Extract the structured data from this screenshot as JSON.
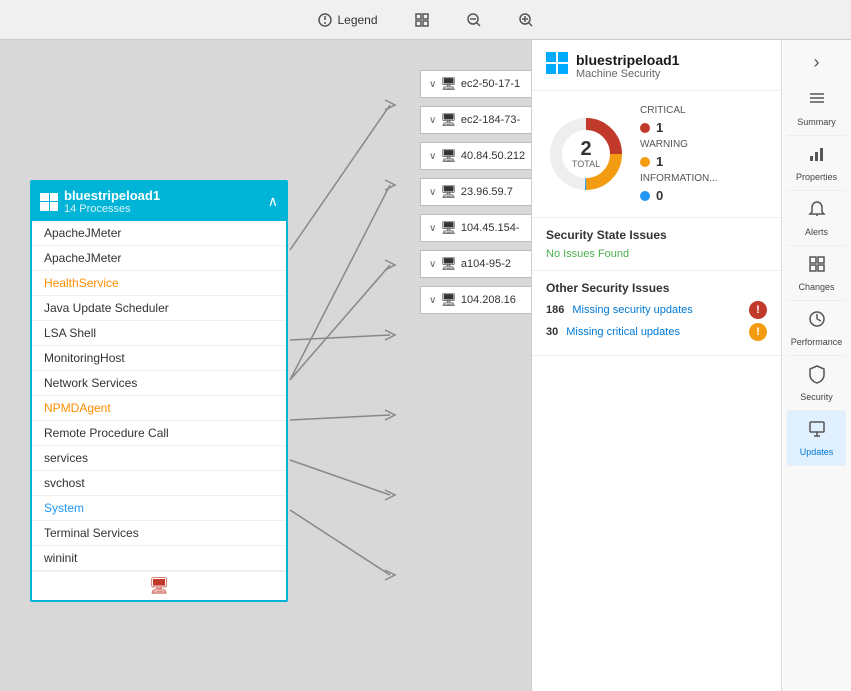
{
  "toolbar": {
    "legend_label": "Legend",
    "icons": [
      "fit-icon",
      "zoom-in-icon",
      "zoom-out-icon"
    ]
  },
  "node_card": {
    "title": "bluestripeload1",
    "subtitle": "14 Processes",
    "processes": [
      {
        "name": "ApacheJMeter",
        "style": "normal",
        "connected_right": true
      },
      {
        "name": "ApacheJMeter",
        "style": "normal",
        "connected_right": false
      },
      {
        "name": "HealthService",
        "style": "orange",
        "connected_right": false
      },
      {
        "name": "Java Update Scheduler",
        "style": "normal",
        "connected_right": false
      },
      {
        "name": "LSA Shell",
        "style": "normal",
        "connected_right": false
      },
      {
        "name": "MonitoringHost",
        "style": "normal",
        "connected_right": true
      },
      {
        "name": "Network Services",
        "style": "normal",
        "connected_right": false
      },
      {
        "name": "NPMDAgent",
        "style": "orange",
        "connected_right": false,
        "connected_left": true
      },
      {
        "name": "Remote Procedure Call",
        "style": "normal",
        "connected_right": false
      },
      {
        "name": "services",
        "style": "normal",
        "connected_right": false
      },
      {
        "name": "svchost",
        "style": "normal",
        "connected_right": false
      },
      {
        "name": "System",
        "style": "blue",
        "connected_right": false,
        "connected_left": true
      },
      {
        "name": "Terminal Services",
        "style": "normal",
        "connected_right": false,
        "connected_left": true
      },
      {
        "name": "wininit",
        "style": "normal",
        "connected_right": false
      }
    ]
  },
  "remote_nodes": [
    {
      "id": "ec2-50-17-1",
      "collapsed": true
    },
    {
      "id": "ec2-184-73-",
      "collapsed": true
    },
    {
      "id": "40.84.50.212",
      "collapsed": true
    },
    {
      "id": "23.96.59.7",
      "collapsed": true
    },
    {
      "id": "104.45.154-",
      "collapsed": true
    },
    {
      "id": "a104-95-2",
      "collapsed": true
    },
    {
      "id": "104.208.16",
      "collapsed": true
    }
  ],
  "right_panel": {
    "title": "bluestripeload1",
    "subtitle": "Machine Security",
    "donut": {
      "total": 2,
      "total_label": "TOTAL",
      "critical_label": "CRITICAL",
      "critical_value": 1,
      "warning_label": "WARNING",
      "warning_value": 1,
      "information_label": "INFORMATION...",
      "information_value": 0,
      "critical_color": "#c0392b",
      "warning_color": "#f39c12",
      "information_color": "#2196F3"
    },
    "security_state": {
      "title": "Security State Issues",
      "status": "No Issues Found"
    },
    "other_issues": {
      "title": "Other Security Issues",
      "items": [
        {
          "count": "186",
          "label": "Missing security updates",
          "badge": "red"
        },
        {
          "count": "30",
          "label": "Missing critical updates",
          "badge": "yellow"
        }
      ]
    }
  },
  "nav": {
    "items": [
      {
        "label": "Summary",
        "icon": "≡"
      },
      {
        "label": "Properties",
        "icon": "▦"
      },
      {
        "label": "Alerts",
        "icon": "🔔"
      },
      {
        "label": "Changes",
        "icon": "⊞"
      },
      {
        "label": "Performance",
        "icon": "⏱"
      },
      {
        "label": "Security",
        "icon": "🛡"
      },
      {
        "label": "Updates",
        "icon": "⊡"
      }
    ],
    "active_index": 6
  }
}
